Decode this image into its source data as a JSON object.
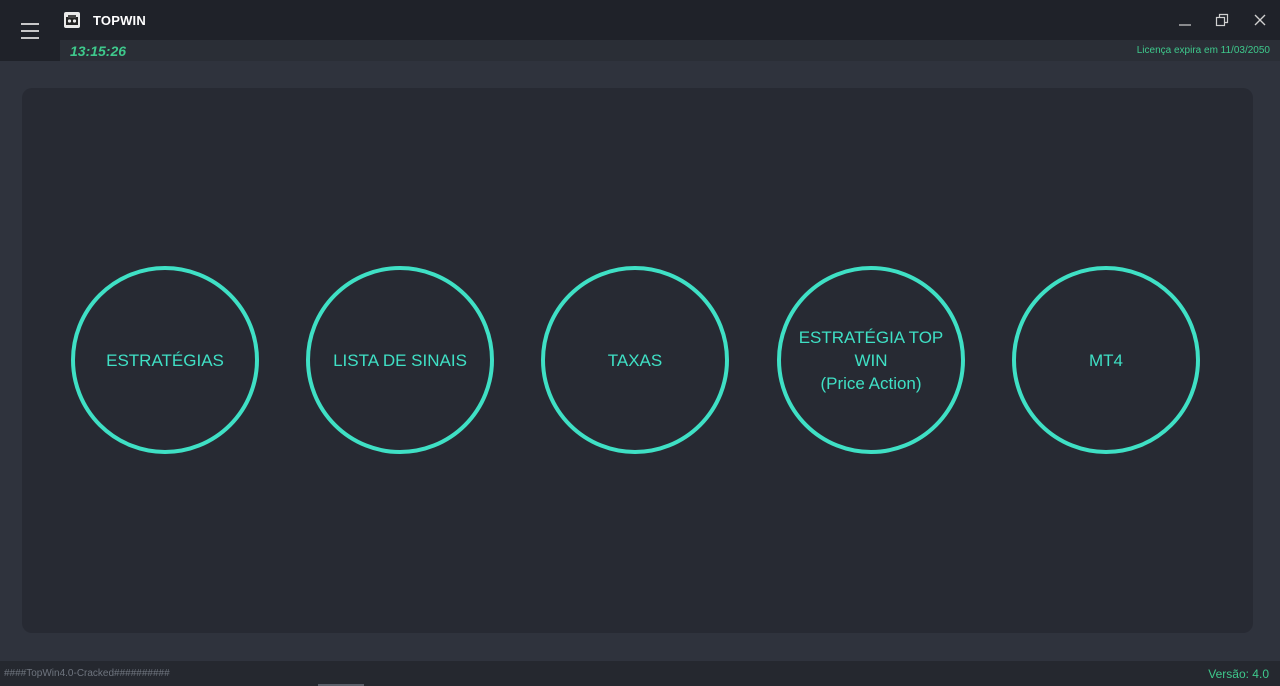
{
  "window": {
    "title": "TOPWIN",
    "controls": [
      "minimize",
      "restore",
      "close"
    ]
  },
  "status": {
    "time": "13:15:26",
    "license": "Licença expira em 11/03/2050"
  },
  "menu": [
    {
      "label": "ESTRATÉGIAS"
    },
    {
      "label": "LISTA DE SINAIS"
    },
    {
      "label": "TAXAS"
    },
    {
      "label": "ESTRATÉGIA TOP WIN\n(Price Action)"
    },
    {
      "label": "MT4"
    }
  ],
  "footer": {
    "left": "####TopWin4.0-Cracked##########",
    "version": "Versão: 4.0"
  },
  "colors": {
    "accent": "#3fe0c5",
    "status_green": "#3ec98c",
    "background": "#2f333d",
    "panel": "#272a33"
  }
}
